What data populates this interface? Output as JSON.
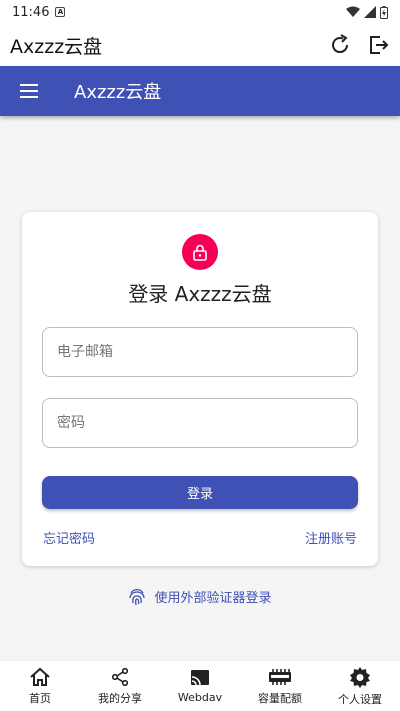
{
  "status_bar": {
    "time": "11:46",
    "badge": "A"
  },
  "app_bar": {
    "title": "Axzzz云盘"
  },
  "nav_bar": {
    "title": "Axzzz云盘"
  },
  "login_card": {
    "title": "登录 Axzzz云盘",
    "email_placeholder": "电子邮箱",
    "password_placeholder": "密码",
    "login_button": "登录",
    "forgot_password": "忘记密码",
    "register": "注册账号"
  },
  "external_login": {
    "label": "使用外部验证器登录"
  },
  "bottom_nav": {
    "items": [
      {
        "label": "首页",
        "icon": "home-icon"
      },
      {
        "label": "我的分享",
        "icon": "share-icon"
      },
      {
        "label": "Webdav",
        "icon": "cast-icon"
      },
      {
        "label": "容量配额",
        "icon": "memory-icon"
      },
      {
        "label": "个人设置",
        "icon": "gear-icon"
      }
    ]
  },
  "colors": {
    "primary": "#3f51b5",
    "accent": "#f50057"
  }
}
